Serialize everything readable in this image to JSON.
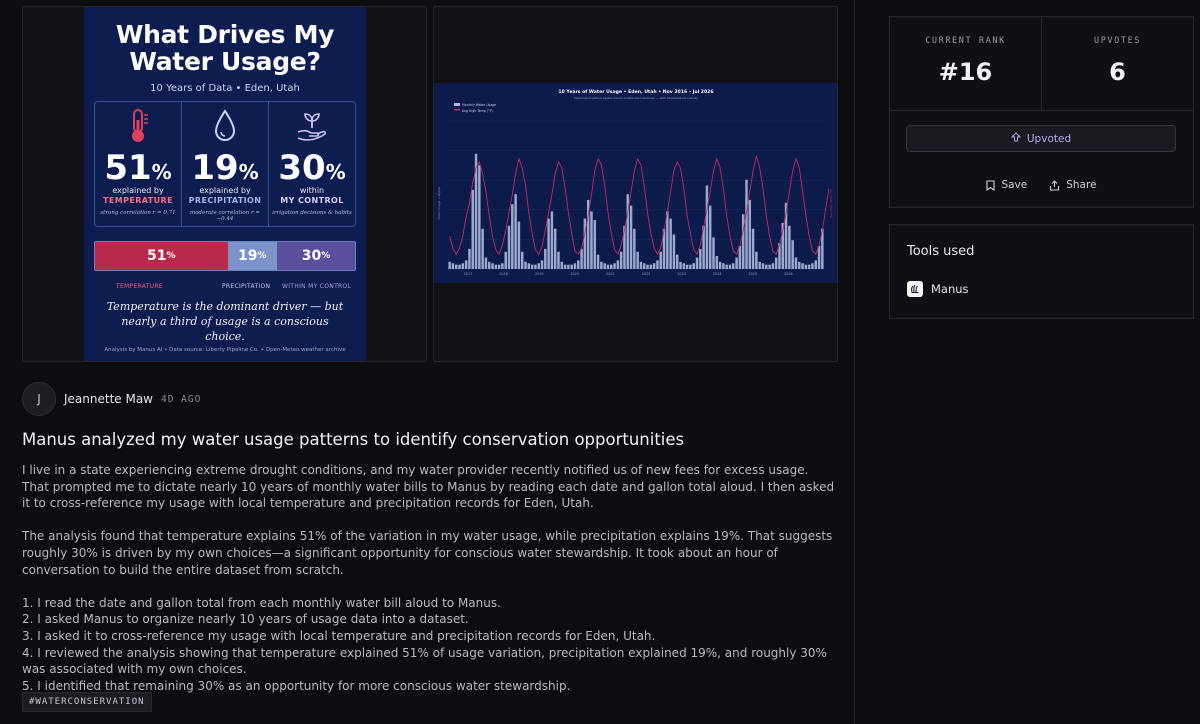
{
  "gallery": {
    "infographic": {
      "title": "What Drives My Water Usage?",
      "subtitle": "10 Years of Data • Eden, Utah",
      "stats": [
        {
          "icon": "thermometer-icon",
          "num": "51",
          "unit": "%",
          "line1": "explained by",
          "line2": "TEMPERATURE",
          "line3": "strong correlation r = 0.71",
          "color": "#e0405e"
        },
        {
          "icon": "water-drop-icon",
          "num": "19",
          "unit": "%",
          "line1": "explained by",
          "line2": "PRECIPITATION",
          "line3": "moderate correlation r = −0.44",
          "color": "#9fb4ea"
        },
        {
          "icon": "hand-plant-icon",
          "num": "30",
          "unit": "%",
          "line1": "within",
          "line2": "MY CONTROL",
          "line3": "irrigation decisions & habits",
          "color": "#c9c2f0"
        }
      ],
      "bar": [
        {
          "num": "51",
          "unit": "%",
          "label": "TEMPERATURE",
          "share": 51,
          "color": "#b9294b"
        },
        {
          "num": "19",
          "unit": "%",
          "label": "PRECIPITATION",
          "share": 19,
          "color": "#7d92c8"
        },
        {
          "num": "30",
          "unit": "%",
          "label": "WITHIN MY CONTROL",
          "share": 30,
          "color": "#5a4f9c"
        }
      ],
      "quote": "Temperature is the dominant driver — but nearly a third of usage is a conscious choice.",
      "footer": "Analysis by Manus AI  •  Data source: Liberty Pipeline Co.  •  Open-Meteo weather archive"
    }
  },
  "chart_data": {
    "type": "bar",
    "title": "10 Years of Water Usage • Eden, Utah • Nov 2016 – Jul 2026",
    "subtitle": "Seasonal irrigation peaks clearly visible each summer — with temperature overlay",
    "ylabel": "Water Usage →  Higher",
    "ylabel_right": "Avg High Temp (°F)",
    "legend_position": "top-left",
    "x_ticks": [
      "2017",
      "2018",
      "2019",
      "2020",
      "2021",
      "2022",
      "2023",
      "2024",
      "2025",
      "2026"
    ],
    "series": [
      {
        "name": "Monthly Water Usage",
        "kind": "bar",
        "color": "#a9b8da",
        "values": [
          5,
          4,
          3,
          3,
          4,
          6,
          14,
          55,
          80,
          72,
          28,
          8,
          5,
          4,
          3,
          3,
          4,
          12,
          30,
          45,
          52,
          33,
          12,
          5,
          4,
          3,
          3,
          4,
          6,
          14,
          35,
          40,
          28,
          12,
          5,
          3,
          3,
          3,
          4,
          6,
          14,
          35,
          48,
          40,
          34,
          10,
          5,
          4,
          3,
          3,
          4,
          6,
          12,
          30,
          52,
          44,
          28,
          12,
          5,
          4,
          3,
          3,
          4,
          6,
          12,
          28,
          40,
          35,
          24,
          10,
          5,
          4,
          3,
          3,
          4,
          8,
          14,
          30,
          58,
          44,
          22,
          9,
          5,
          4,
          3,
          3,
          4,
          8,
          16,
          38,
          62,
          48,
          28,
          12,
          5,
          4,
          3,
          3,
          4,
          8,
          18,
          32,
          46,
          30,
          20,
          8,
          5,
          4,
          3,
          3,
          4,
          6,
          16,
          28
        ]
      },
      {
        "name": "Avg High Temp (°F)",
        "kind": "line",
        "color": "#c8285a",
        "values": [
          42,
          34,
          30,
          34,
          42,
          55,
          64,
          78,
          88,
          92,
          84,
          72,
          56,
          42,
          33,
          30,
          36,
          46,
          58,
          70,
          84,
          94,
          88,
          76,
          58,
          44,
          33,
          30,
          35,
          46,
          58,
          70,
          84,
          92,
          88,
          74,
          58,
          44,
          32,
          30,
          34,
          44,
          56,
          70,
          86,
          94,
          90,
          76,
          58,
          44,
          33,
          30,
          36,
          46,
          58,
          72,
          86,
          94,
          90,
          76,
          58,
          44,
          34,
          30,
          34,
          46,
          58,
          72,
          86,
          92,
          88,
          74,
          56,
          44,
          33,
          30,
          36,
          48,
          60,
          72,
          86,
          94,
          88,
          74,
          56,
          42,
          32,
          30,
          36,
          46,
          58,
          72,
          86,
          96,
          88,
          74,
          56,
          42,
          32,
          30,
          36,
          46,
          58,
          72,
          86,
          94,
          88,
          72,
          56,
          42,
          32,
          30,
          36,
          46,
          60,
          74
        ]
      }
    ]
  },
  "author": {
    "initial": "J",
    "name": "Jeannette Maw",
    "ago": "4D AGO"
  },
  "post": {
    "title": "Manus analyzed my water usage patterns to identify conservation opportunities",
    "p1": "I live in a state experiencing extreme drought conditions, and my water provider recently notified us of new fees for excess usage. That prompted me to dictate nearly 10 years of monthly water bills to Manus by reading each date and gallon total aloud. I then asked it to cross-reference my usage with local temperature and precipitation records for Eden, Utah.",
    "p2": "The analysis found that temperature explains 51% of the variation in my water usage, while precipitation explains 19%. That suggests roughly 30% is driven by my own choices—a significant opportunity for conscious water stewardship. It took about an hour of conversation to build the entire dataset from scratch.",
    "steps": [
      "1. I read the date and gallon total from each monthly water bill aloud to Manus.",
      "2. I asked Manus to organize nearly 10 years of usage data into a dataset.",
      "3. I asked it to cross-reference my usage with local temperature and precipitation records for Eden, Utah.",
      "4. I reviewed the analysis showing that temperature explained 51% of usage variation, precipitation explained 19%, and roughly 30% was associated with my own choices.",
      "5. I identified that remaining 30% as an opportunity for more conscious water stewardship."
    ],
    "tag": "#WATERCONSERVATION"
  },
  "sidebar": {
    "rank_label": "CURRENT RANK",
    "rank_value": "#16",
    "upvotes_label": "UPVOTES",
    "upvotes_value": "6",
    "upvote_button": "Upvoted",
    "save_label": "Save",
    "share_label": "Share",
    "tools_heading": "Tools used",
    "tool_name": "Manus"
  }
}
